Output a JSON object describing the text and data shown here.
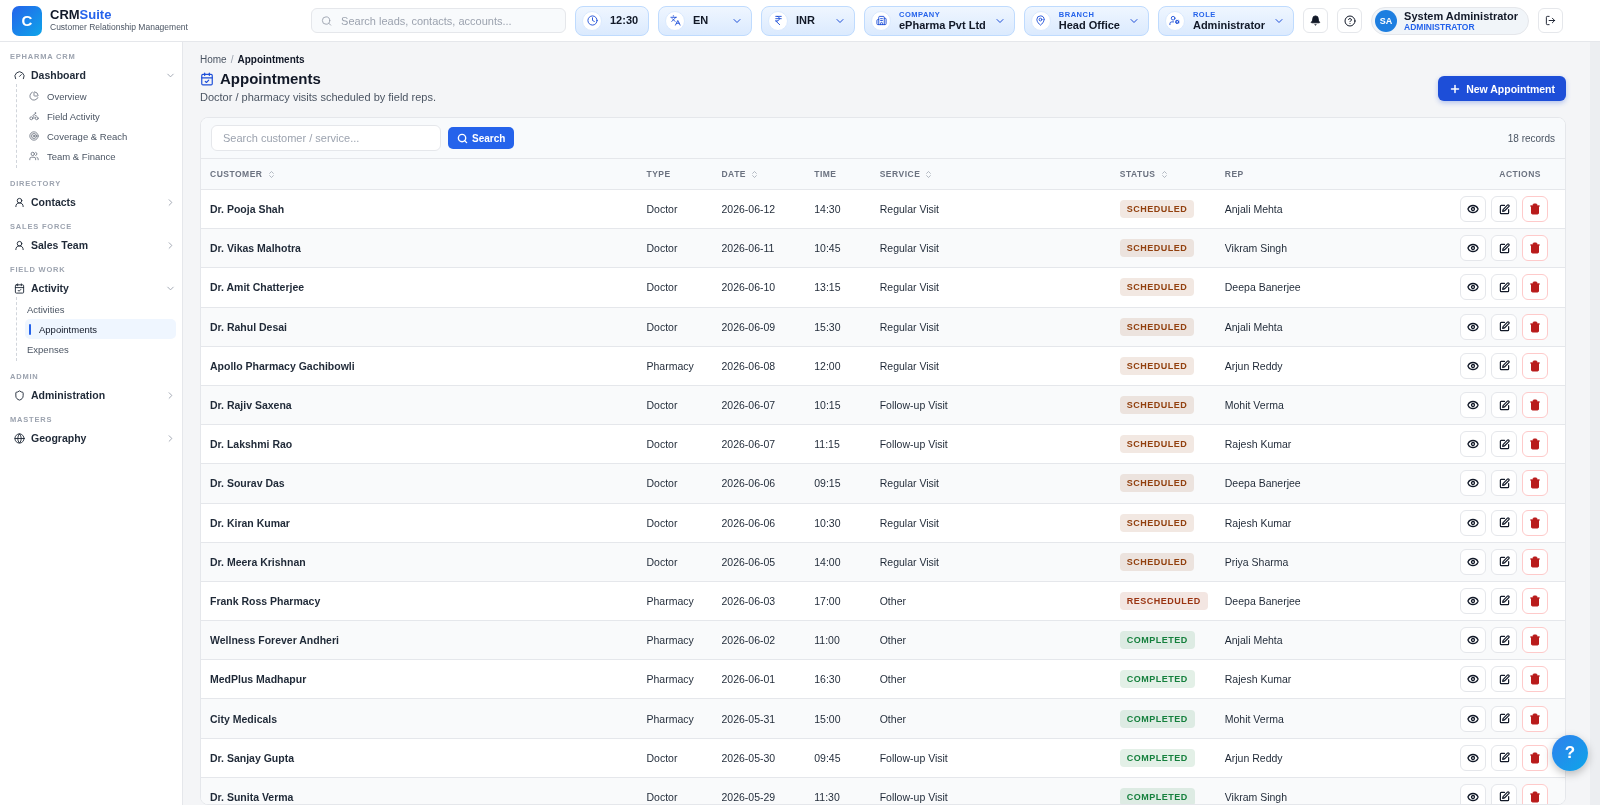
{
  "brand": {
    "name_main": "CRM",
    "name_accent": "Suite",
    "tagline": "Customer Relationship Management",
    "logo_letter": "C"
  },
  "header": {
    "search": {
      "placeholder": "Search leads, contacts, accounts..."
    },
    "pills": [
      {
        "kind": "time",
        "value": "12:30",
        "dropdown": false
      },
      {
        "kind": "language",
        "value": "EN",
        "dropdown": true
      },
      {
        "kind": "currency",
        "value": "INR",
        "dropdown": true
      },
      {
        "kind": "company",
        "label": "COMPANY",
        "value": "ePharma Pvt Ltd",
        "dropdown": true
      },
      {
        "kind": "branch",
        "label": "BRANCH",
        "value": "Head Office",
        "dropdown": true
      },
      {
        "kind": "role",
        "label": "ROLE",
        "value": "Administrator",
        "dropdown": true
      }
    ],
    "user": {
      "initials": "SA",
      "name": "System Administrator",
      "role": "ADMINISTRATOR"
    }
  },
  "sidebar": [
    {
      "heading": "EPHARMA CRM",
      "items": [
        {
          "label": "Dashboard",
          "expanded": true,
          "children": [
            {
              "label": "Overview",
              "selected": false
            },
            {
              "label": "Field Activity",
              "selected": false
            },
            {
              "label": "Coverage & Reach",
              "selected": false
            },
            {
              "label": "Team & Finance",
              "selected": false
            }
          ]
        }
      ]
    },
    {
      "heading": "DIRECTORY",
      "items": [
        {
          "label": "Contacts",
          "expanded": false
        }
      ]
    },
    {
      "heading": "SALES FORCE",
      "items": [
        {
          "label": "Sales Team",
          "expanded": false
        }
      ]
    },
    {
      "heading": "FIELD WORK",
      "items": [
        {
          "label": "Activity",
          "expanded": true,
          "children": [
            {
              "label": "Activities",
              "selected": false
            },
            {
              "label": "Appointments",
              "selected": true
            },
            {
              "label": "Expenses",
              "selected": false
            }
          ]
        }
      ]
    },
    {
      "heading": "ADMIN",
      "items": [
        {
          "label": "Administration",
          "expanded": false
        }
      ]
    },
    {
      "heading": "MASTERS",
      "items": [
        {
          "label": "Geography",
          "expanded": false
        }
      ]
    }
  ],
  "breadcrumb": {
    "items": [
      "Home",
      "Appointments"
    ],
    "separator": "/"
  },
  "page": {
    "title": "Appointments",
    "subtitle": "Doctor / pharmacy visits scheduled by field reps.",
    "new_button": "New Appointment"
  },
  "table": {
    "search": {
      "placeholder": "Search customer / service...",
      "button": "Search"
    },
    "record_count": "18 records",
    "columns": [
      {
        "label": "CUSTOMER",
        "sortable": true
      },
      {
        "label": "TYPE",
        "sortable": false
      },
      {
        "label": "DATE",
        "sortable": true
      },
      {
        "label": "TIME",
        "sortable": false
      },
      {
        "label": "SERVICE",
        "sortable": true
      },
      {
        "label": "STATUS",
        "sortable": true
      },
      {
        "label": "REP",
        "sortable": false
      },
      {
        "label": "ACTIONS",
        "sortable": false
      }
    ],
    "rows": [
      {
        "customer": "Dr. Pooja Shah",
        "type": "Doctor",
        "date": "2026-06-12",
        "time": "14:30",
        "service": "Regular Visit",
        "status": {
          "text": "SCHEDULED",
          "color": "#92400e"
        },
        "rep": "Anjali Mehta"
      },
      {
        "customer": "Dr. Vikas Malhotra",
        "type": "Doctor",
        "date": "2026-06-11",
        "time": "10:45",
        "service": "Regular Visit",
        "status": {
          "text": "SCHEDULED",
          "color": "#92400e"
        },
        "rep": "Vikram Singh"
      },
      {
        "customer": "Dr. Amit Chatterjee",
        "type": "Doctor",
        "date": "2026-06-10",
        "time": "13:15",
        "service": "Regular Visit",
        "status": {
          "text": "SCHEDULED",
          "color": "#92400e"
        },
        "rep": "Deepa Banerjee"
      },
      {
        "customer": "Dr. Rahul Desai",
        "type": "Doctor",
        "date": "2026-06-09",
        "time": "15:30",
        "service": "Regular Visit",
        "status": {
          "text": "SCHEDULED",
          "color": "#92400e"
        },
        "rep": "Anjali Mehta"
      },
      {
        "customer": "Apollo Pharmacy Gachibowli",
        "type": "Pharmacy",
        "date": "2026-06-08",
        "time": "12:00",
        "service": "Regular Visit",
        "status": {
          "text": "SCHEDULED",
          "color": "#92400e"
        },
        "rep": "Arjun Reddy"
      },
      {
        "customer": "Dr. Rajiv Saxena",
        "type": "Doctor",
        "date": "2026-06-07",
        "time": "10:15",
        "service": "Follow-up Visit",
        "status": {
          "text": "SCHEDULED",
          "color": "#92400e"
        },
        "rep": "Mohit Verma"
      },
      {
        "customer": "Dr. Lakshmi Rao",
        "type": "Doctor",
        "date": "2026-06-07",
        "time": "11:15",
        "service": "Follow-up Visit",
        "status": {
          "text": "SCHEDULED",
          "color": "#92400e"
        },
        "rep": "Rajesh Kumar"
      },
      {
        "customer": "Dr. Sourav Das",
        "type": "Doctor",
        "date": "2026-06-06",
        "time": "09:15",
        "service": "Regular Visit",
        "status": {
          "text": "SCHEDULED",
          "color": "#92400e"
        },
        "rep": "Deepa Banerjee"
      },
      {
        "customer": "Dr. Kiran Kumar",
        "type": "Doctor",
        "date": "2026-06-06",
        "time": "10:30",
        "service": "Regular Visit",
        "status": {
          "text": "SCHEDULED",
          "color": "#92400e"
        },
        "rep": "Rajesh Kumar"
      },
      {
        "customer": "Dr. Meera Krishnan",
        "type": "Doctor",
        "date": "2026-06-05",
        "time": "14:00",
        "service": "Regular Visit",
        "status": {
          "text": "SCHEDULED",
          "color": "#92400e"
        },
        "rep": "Priya Sharma"
      },
      {
        "customer": "Frank Ross Pharmacy",
        "type": "Pharmacy",
        "date": "2026-06-03",
        "time": "17:00",
        "service": "Other",
        "status": {
          "text": "RESCHEDULED",
          "color": "#9a3412"
        },
        "rep": "Deepa Banerjee"
      },
      {
        "customer": "Wellness Forever Andheri",
        "type": "Pharmacy",
        "date": "2026-06-02",
        "time": "11:00",
        "service": "Other",
        "status": {
          "text": "COMPLETED",
          "color": "#15803d"
        },
        "rep": "Anjali Mehta"
      },
      {
        "customer": "MedPlus Madhapur",
        "type": "Pharmacy",
        "date": "2026-06-01",
        "time": "16:30",
        "service": "Other",
        "status": {
          "text": "COMPLETED",
          "color": "#15803d"
        },
        "rep": "Rajesh Kumar"
      },
      {
        "customer": "City Medicals",
        "type": "Pharmacy",
        "date": "2026-05-31",
        "time": "15:00",
        "service": "Other",
        "status": {
          "text": "COMPLETED",
          "color": "#15803d"
        },
        "rep": "Mohit Verma"
      },
      {
        "customer": "Dr. Sanjay Gupta",
        "type": "Doctor",
        "date": "2026-05-30",
        "time": "09:45",
        "service": "Follow-up Visit",
        "status": {
          "text": "COMPLETED",
          "color": "#15803d"
        },
        "rep": "Arjun Reddy"
      },
      {
        "customer": "Dr. Sunita Verma",
        "type": "Doctor",
        "date": "2026-05-29",
        "time": "11:30",
        "service": "Follow-up Visit",
        "status": {
          "text": "COMPLETED",
          "color": "#15803d"
        },
        "rep": "Vikram Singh"
      }
    ]
  },
  "help_button": "?"
}
